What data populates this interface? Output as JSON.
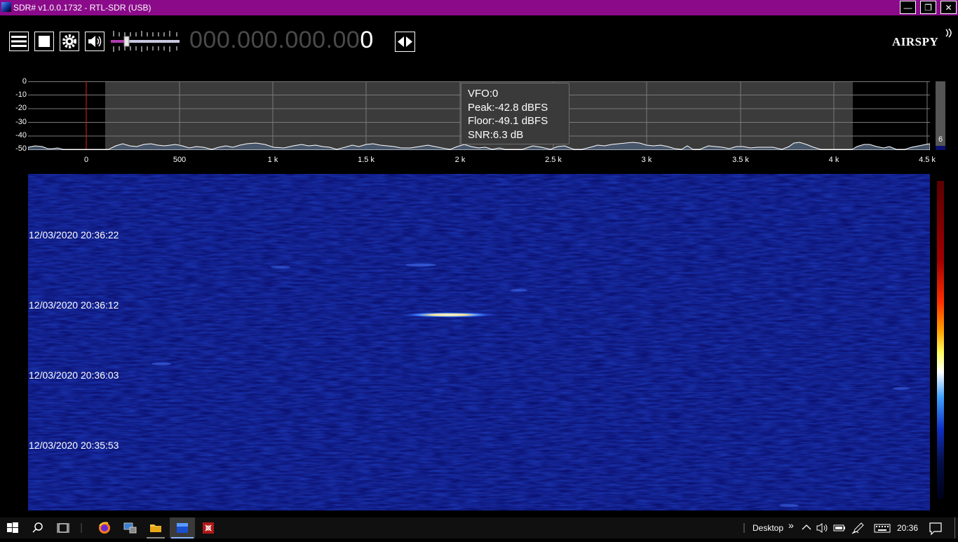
{
  "window": {
    "title": "SDR# v1.0.0.1732 - RTL-SDR (USB)"
  },
  "frequency": {
    "dim": "000.000.000.00",
    "lit": "0"
  },
  "logo": "AIRSPY",
  "spectrum": {
    "y_labels": [
      "0",
      "-10",
      "-20",
      "-30",
      "-40",
      "-50"
    ],
    "x_labels": [
      "0",
      "500",
      "1 k",
      "1.5 k",
      "2 k",
      "2.5 k",
      "3 k",
      "3.5 k",
      "4 k",
      "4.5 k"
    ],
    "tooltip": {
      "vfo": "VFO:0",
      "peak": "Peak:-42.8 dBFS",
      "floor": "Floor:-49.1 dBFS",
      "snr": "SNR:6.3 dB"
    },
    "gain_value": "6"
  },
  "waterfall": {
    "timestamps": [
      "12/03/2020 20:36:22",
      "12/03/2020 20:36:12",
      "12/03/2020 20:36:03",
      "12/03/2020 20:35:53"
    ]
  },
  "taskbar": {
    "desktop_label": "Desktop",
    "chevron": "»",
    "clock": "20:36"
  },
  "colors": {
    "title_bar": "#8a0a8a",
    "waterfall_bg": "#0a0f6e",
    "spectrum_fill": "#3b3b3b"
  }
}
